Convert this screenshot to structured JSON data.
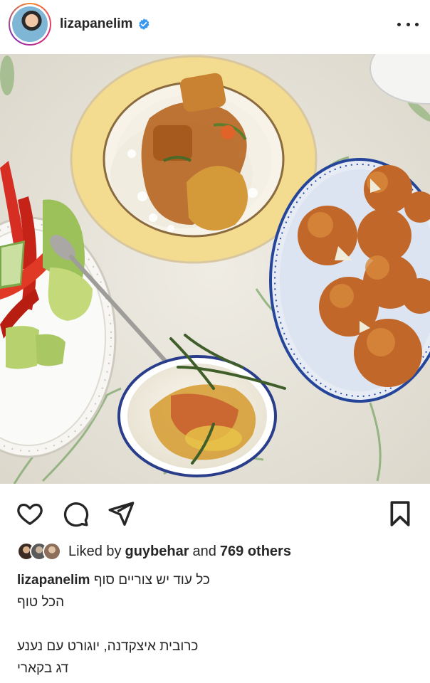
{
  "post": {
    "username": "lizapanelim",
    "verified": true
  },
  "actions": {
    "like_icon": "heart-icon",
    "comment_icon": "comment-icon",
    "share_icon": "paper-plane-icon",
    "save_icon": "bookmark-icon"
  },
  "likes": {
    "prefix": "Liked by",
    "user": "guybehar",
    "joiner": "and",
    "count": "769 others"
  },
  "caption": {
    "username": "lizapanelim",
    "line1": "כל עוד יש צוריים סוף",
    "line2": "הכל טוף",
    "line3": "כרובית איצקדנה, יוגורט עם נענע",
    "line4": "דג בקארי"
  },
  "colors": {
    "verified_blue": "#3897f0",
    "text": "#262626"
  }
}
